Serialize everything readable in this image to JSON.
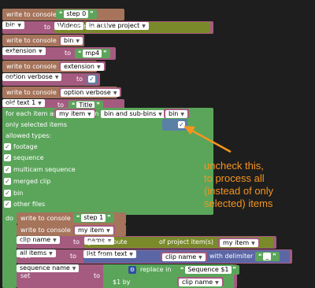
{
  "blocks": {
    "write_console_1": {
      "label": "write to console",
      "value": "step 0"
    },
    "set_bin": {
      "set": "set",
      "var": "bin",
      "to": "to",
      "fn": "project item",
      "path": "\\Videos",
      "scope": "in active project"
    },
    "write_console_2": {
      "label": "write to console",
      "var": "bin"
    },
    "set_extension": {
      "set": "set",
      "var": "extension",
      "to": "to",
      "value": "mp4"
    },
    "write_console_3": {
      "label": "write to console",
      "var": "extension"
    },
    "set_option_verbose": {
      "set": "set",
      "var": "option verbose",
      "to": "to",
      "checked": true
    },
    "write_console_4": {
      "label": "write to console",
      "var": "option verbose"
    },
    "set_old_text": {
      "set": "set",
      "var": "old text 1",
      "to": "to",
      "value": "Title"
    },
    "for_each": {
      "label": "for each item as",
      "var": "my item",
      "in": "in",
      "mode": "bin and sub-bins",
      "bin_var": "bin",
      "only_selected": "only selected items",
      "allowed_types": "allowed types:",
      "types": [
        {
          "label": "footage",
          "checked": true
        },
        {
          "label": "sequence",
          "checked": true
        },
        {
          "label": "multicam sequence",
          "checked": true
        },
        {
          "label": "merged clip",
          "checked": true
        },
        {
          "label": "bin",
          "checked": true
        },
        {
          "label": "other files",
          "checked": true
        }
      ],
      "do": "do"
    },
    "inner_write_1": {
      "label": "write to console",
      "value": "step 1"
    },
    "inner_write_2": {
      "label": "write to console",
      "var": "my item"
    },
    "set_clip_name": {
      "set": "set",
      "var": "clip name",
      "to": "to",
      "fn": "get attribute",
      "attr": "name",
      "of": "of project item(s)",
      "item": "my item"
    },
    "set_all_items": {
      "set": "set",
      "var": "all items",
      "to": "to",
      "fn": "make",
      "mode": "list from text",
      "text_var": "clip name",
      "with": "with delimiter",
      "delim": "_"
    },
    "set_sequence_name": {
      "set": "set",
      "var": "sequence name",
      "to": "to",
      "fn": "replace in",
      "in_value": "Sequence $1",
      "by": "$1 by",
      "by_var": "clip name"
    }
  },
  "annotation": [
    "uncheck this,",
    "to process all",
    "(instead of only",
    "selected) items"
  ],
  "colors": {
    "background": "#1e1e1e",
    "console": "#a5745b",
    "variable": "#a55b80",
    "string": "#5ba55b",
    "loop": "#5ba55b",
    "boolean": "#5b80a5",
    "annotation": "#f7941d"
  }
}
